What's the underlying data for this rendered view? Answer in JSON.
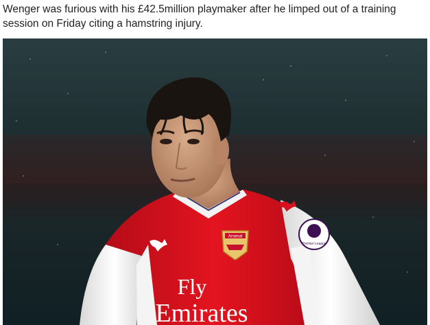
{
  "article": {
    "caption": "Wenger was furious with his £42.5million playmaker after he limped out of a training session on Friday citing a hamstring injury."
  },
  "photo": {
    "subject": "footballer-in-red-and-white-kit",
    "kit": {
      "shirt_sponsor_line1": "Fly",
      "shirt_sponsor_line2": "Emirates",
      "crest_text": "Arsenal",
      "sleeve_badge_text": "Premier League"
    },
    "colors": {
      "shirt_red": "#d9101e",
      "sleeve_white": "#f2f2f2",
      "skin": "#c99a7a",
      "hair": "#1a1410",
      "background_top": "#223437",
      "background_bottom": "#122022"
    }
  }
}
